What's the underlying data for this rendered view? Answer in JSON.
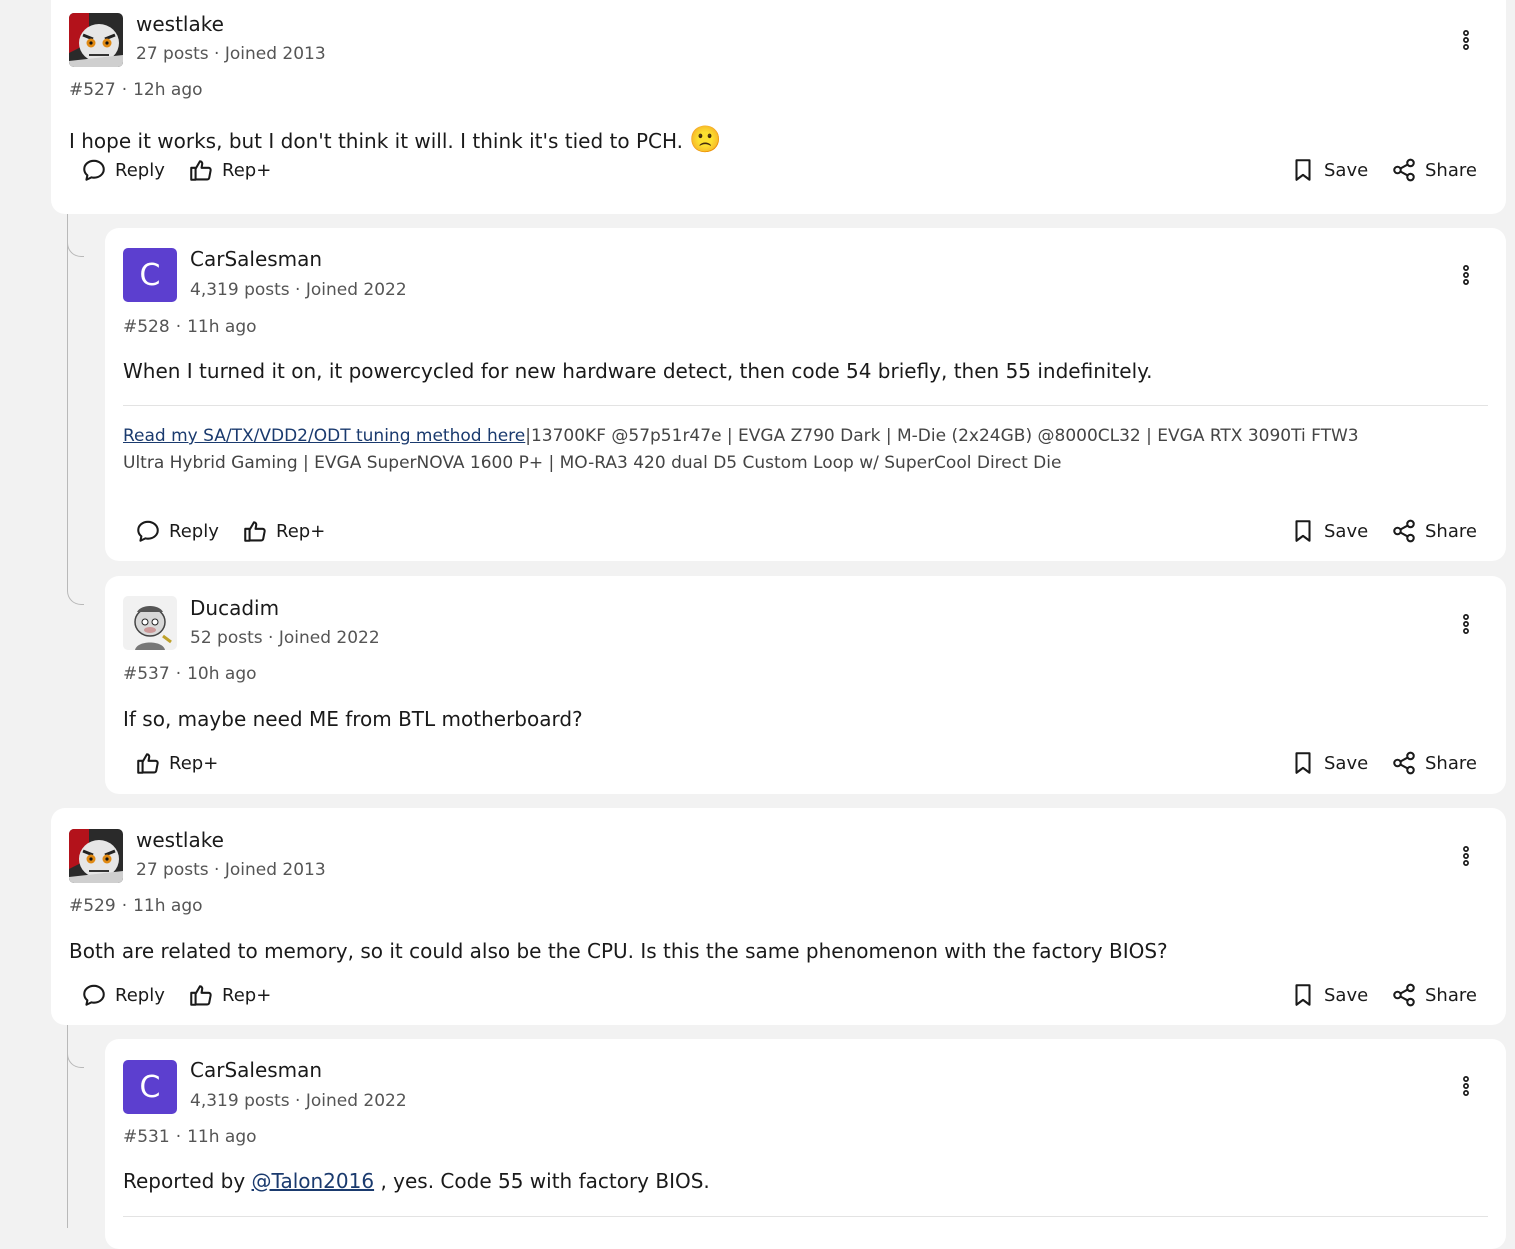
{
  "posts": [
    {
      "username": "westlake",
      "user_meta": "27 posts · Joined 2013",
      "post_number": "#527",
      "post_time": "12h ago",
      "body": "I hope it works, but I don't think it will. I think it's tied to PCH.",
      "emoji": "🙁"
    },
    {
      "avatar_letter": "C",
      "username": "CarSalesman",
      "user_meta": "4,319 posts · Joined 2022",
      "post_number": "#528",
      "post_time": "11h ago",
      "body": "When I turned it on, it powercycled for new hardware detect, then code 54 briefly, then 55 indefinitely.",
      "signature_link": "Read my SA/TX/VDD2/ODT tuning method here",
      "signature_text": "|13700KF @57p51r47e | EVGA Z790 Dark | M-Die (2x24GB) @8000CL32 | EVGA RTX 3090Ti FTW3 Ultra Hybrid Gaming | EVGA SuperNOVA 1600 P+ | MO-RA3 420 dual D5 Custom Loop w/ SuperCool Direct Die"
    },
    {
      "username": "Ducadim",
      "user_meta": "52 posts · Joined 2022",
      "post_number": "#537",
      "post_time": "10h ago",
      "body": "If so, maybe need ME from BTL motherboard?"
    },
    {
      "username": "westlake",
      "user_meta": "27 posts · Joined 2013",
      "post_number": "#529",
      "post_time": "11h ago",
      "body": "Both are related to memory, so it could also be the CPU. Is this the same phenomenon with the factory BIOS?"
    },
    {
      "avatar_letter": "C",
      "username": "CarSalesman",
      "user_meta": "4,319 posts · Joined 2022",
      "post_number": "#531",
      "post_time": "11h ago",
      "body_before": "Reported by",
      "mention": "@Talon2016",
      "body_after": ", yes. Code 55 with factory BIOS."
    }
  ],
  "actions": {
    "reply": "Reply",
    "rep": "Rep+",
    "save": "Save",
    "share": "Share"
  },
  "icons": [
    "reply-icon",
    "thumbs-up-icon",
    "bookmark-icon",
    "share-icon",
    "more-vertical-icon"
  ],
  "colors": {
    "avatar_letter_bg": "#5c3fcf",
    "link": "#1a3a6e",
    "page_bg": "#f2f2f2"
  }
}
